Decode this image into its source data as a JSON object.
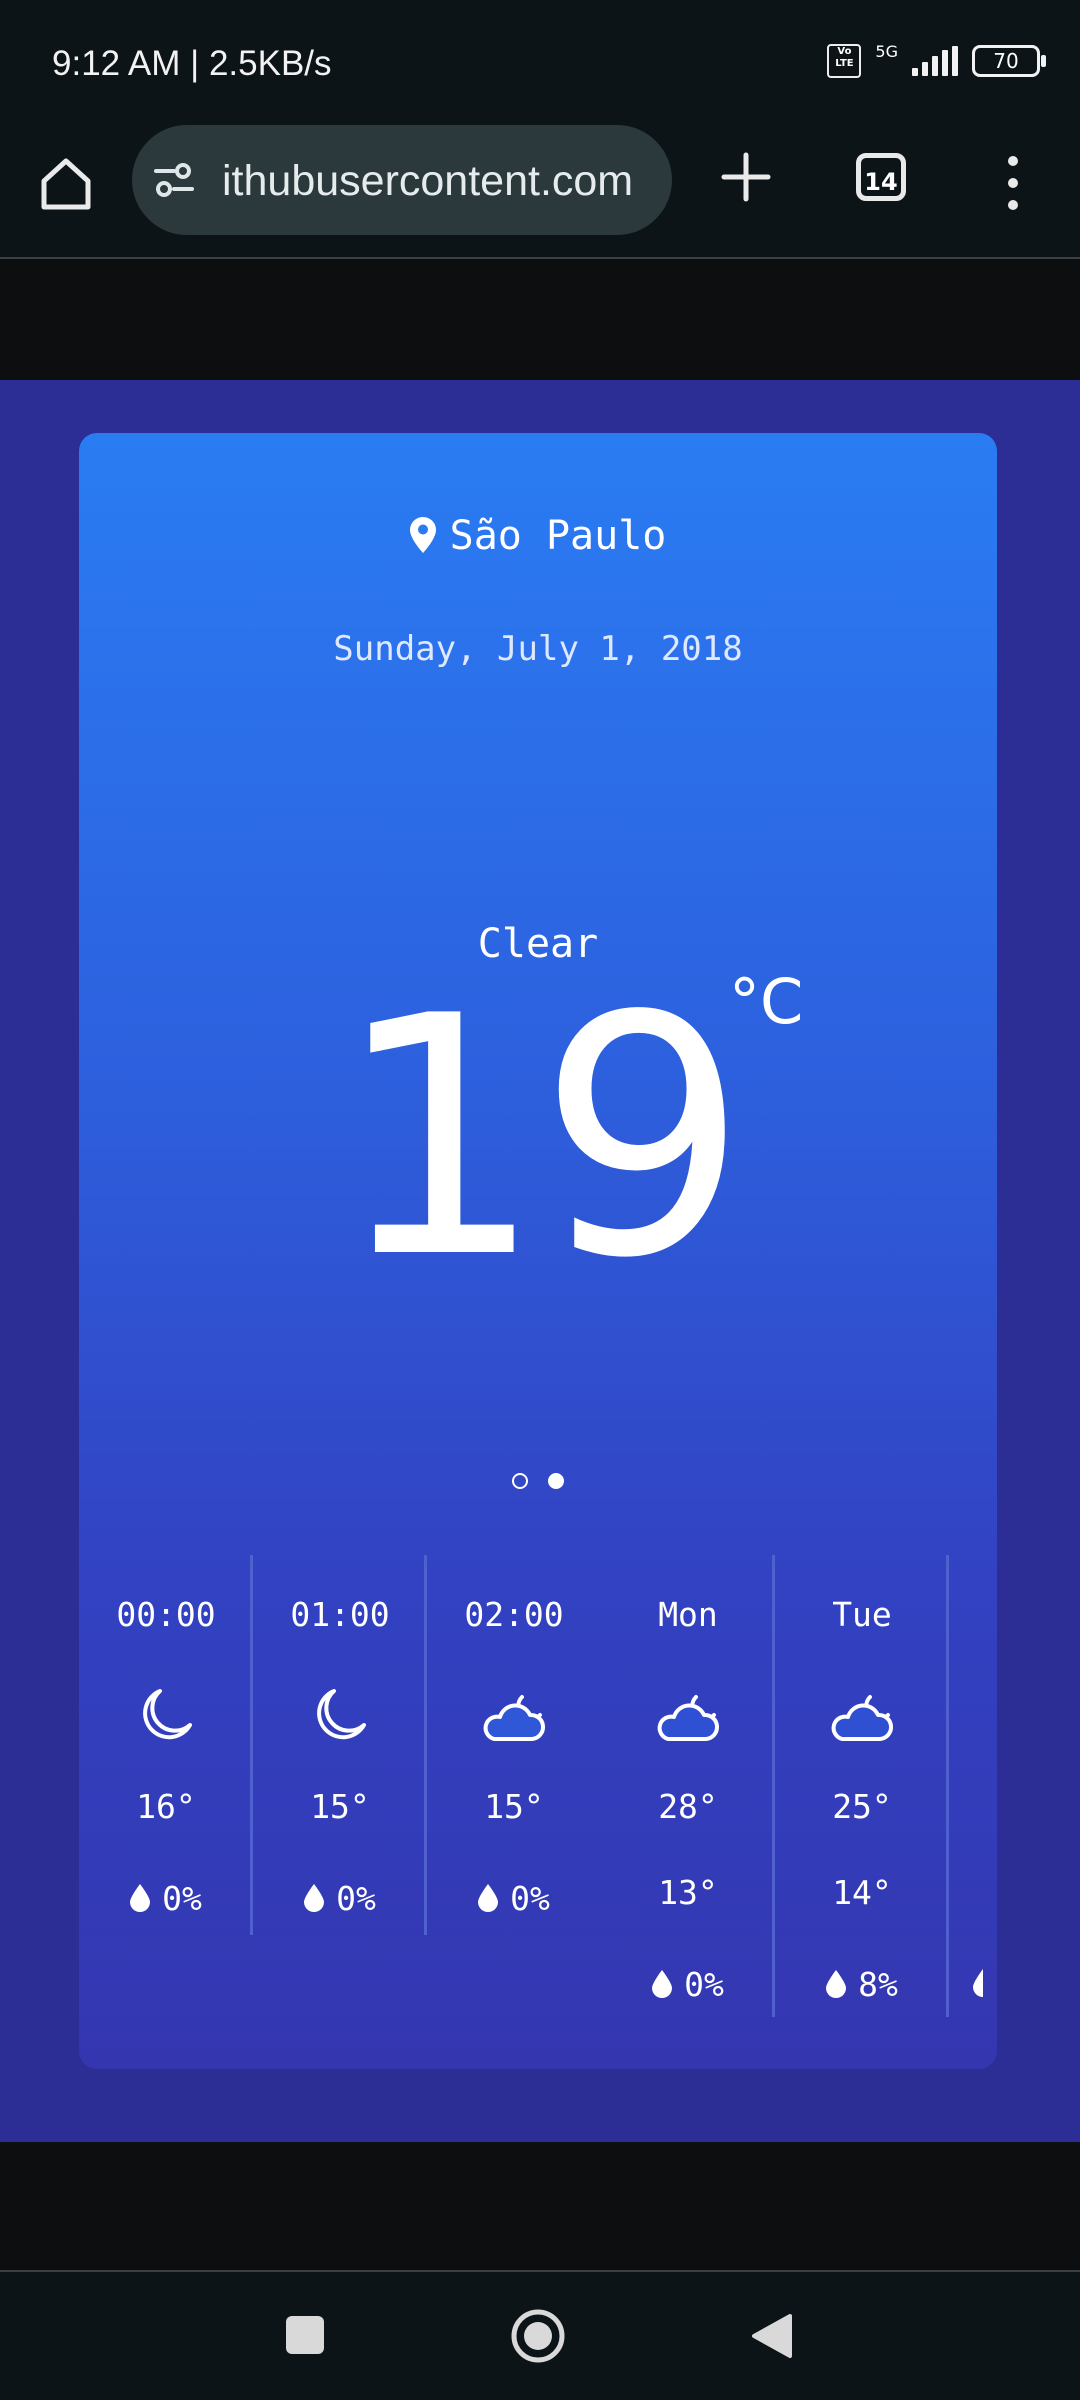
{
  "status_bar": {
    "time_speed": "9:12 AM | 2.5KB/s",
    "volte": "Vo LTE",
    "network": "5G",
    "battery": "70"
  },
  "browser": {
    "url": "ithubusercontent.com",
    "tab_count": "14"
  },
  "weather": {
    "location": "São Paulo",
    "date": "Sunday, July 1, 2018",
    "condition": "Clear",
    "temperature": "19",
    "unit": "°C",
    "pager": {
      "pages": 2,
      "active_index": 1
    },
    "forecast": [
      {
        "label": "00:00",
        "icon": "moon-icon",
        "temp": "16°",
        "rain": "0%"
      },
      {
        "label": "01:00",
        "icon": "moon-icon",
        "temp": "15°",
        "rain": "0%"
      },
      {
        "label": "02:00",
        "icon": "cloud-moon-icon",
        "temp": "15°",
        "rain": "0%"
      },
      {
        "label": "Mon",
        "icon": "cloud-sun-icon",
        "high": "28°",
        "low": "13°",
        "rain": "0%"
      },
      {
        "label": "Tue",
        "icon": "cloud-sun-icon",
        "high": "25°",
        "low": "14°",
        "rain": "8%"
      }
    ]
  },
  "colors": {
    "page_bg": "#2c2e96",
    "card_top": "#2a7cf3",
    "card_bottom": "#3436b0"
  }
}
